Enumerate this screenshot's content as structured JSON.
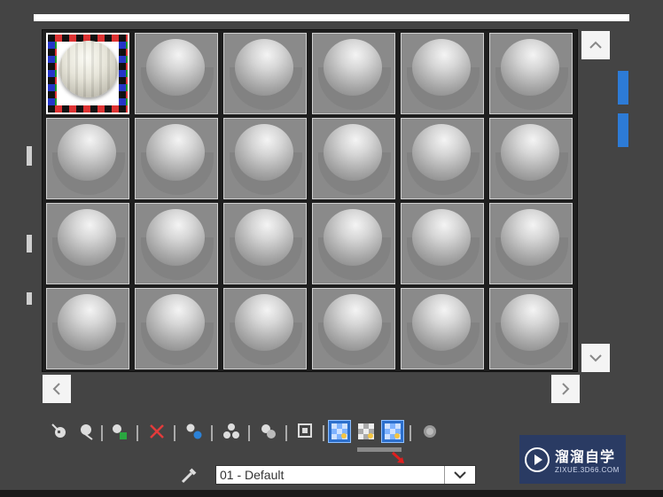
{
  "material_editor": {
    "slots_columns": 6,
    "slots_rows": 4,
    "active_slot_index": 0
  },
  "toolbar": {
    "buttons": [
      {
        "name": "get-material-icon"
      },
      {
        "name": "put-to-scene-icon"
      },
      {
        "name": "assign-to-selection-icon"
      },
      {
        "name": "reset-map-icon"
      },
      {
        "name": "make-unique-icon"
      },
      {
        "name": "put-to-library-icon"
      },
      {
        "name": "material-id-channel-icon"
      },
      {
        "name": "show-shaded-material-icon"
      },
      {
        "name": "show-end-result-icon"
      },
      {
        "name": "show-background-flyout-icon"
      },
      {
        "name": "show-background-flyout-icon-2"
      },
      {
        "name": "go-to-parent-icon"
      }
    ]
  },
  "material_selector": {
    "selected_value": "01 - Default"
  },
  "watermark": {
    "title": "溜溜自学",
    "subtitle": "ZIXUE.3D66.COM"
  },
  "colors": {
    "background": "#444444",
    "slot_fill": "#8a8a8a",
    "highlight": "#2c6fcc",
    "accent_blue": "#2d7bd6"
  }
}
